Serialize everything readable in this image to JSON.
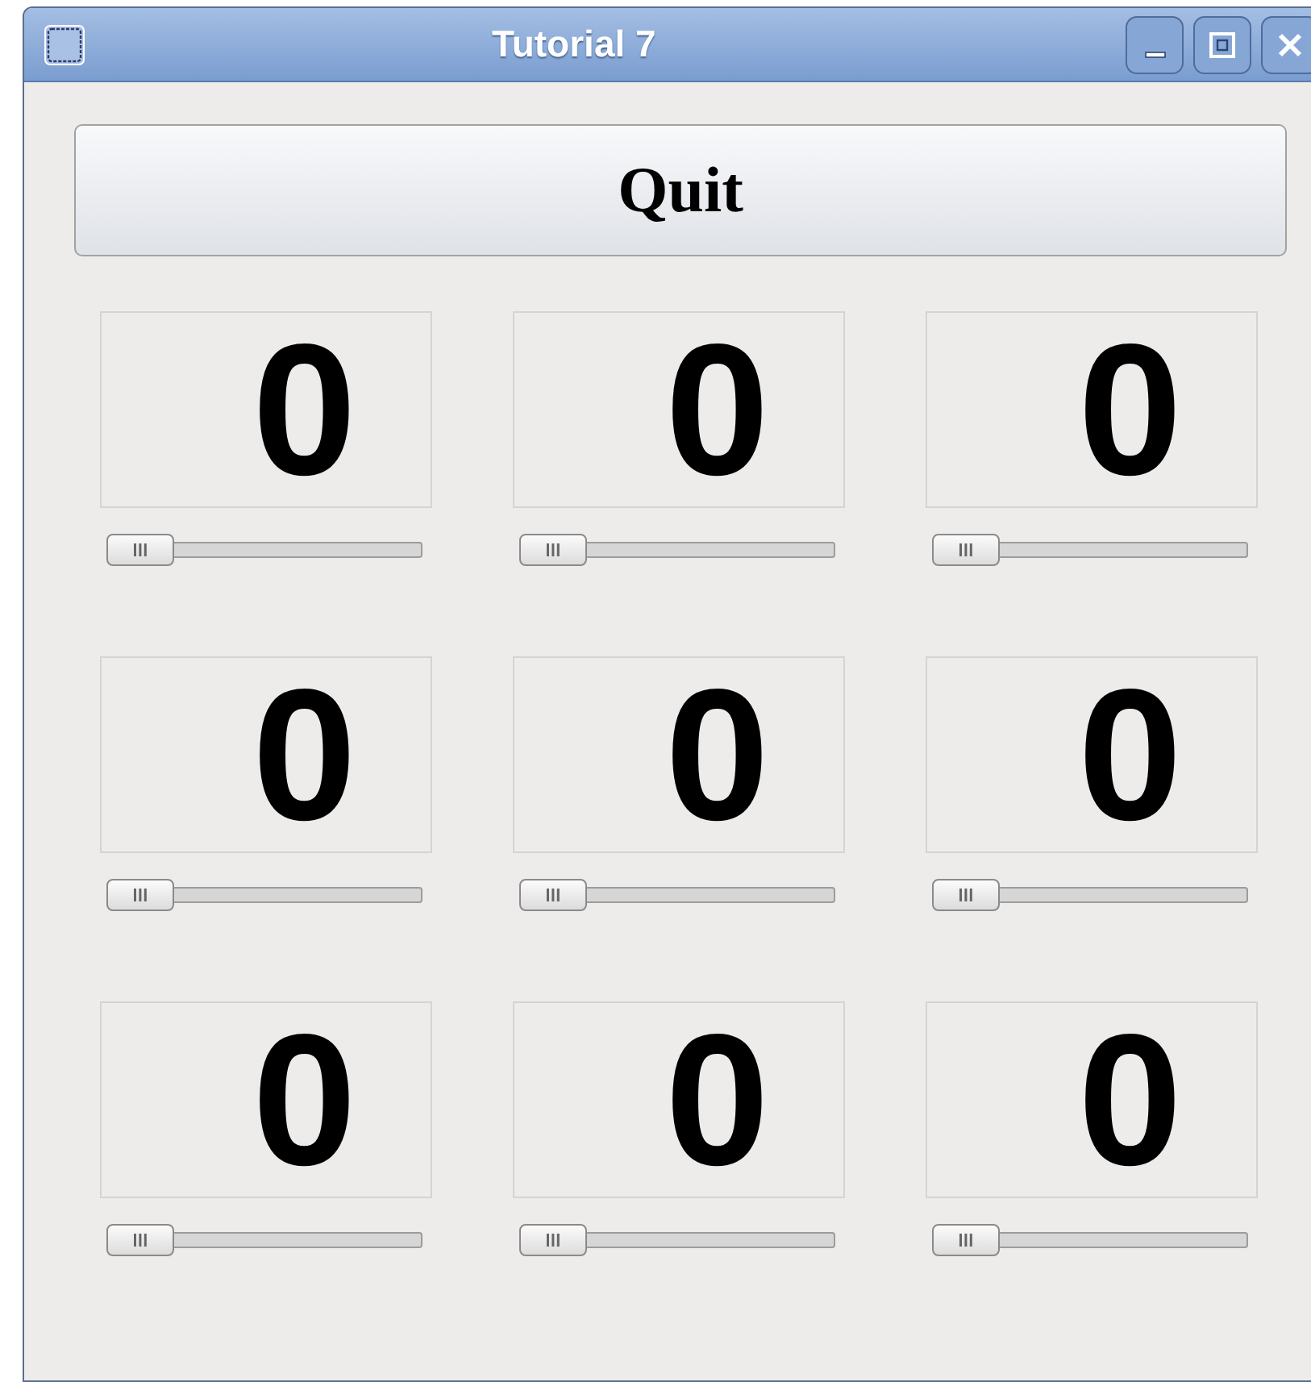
{
  "window": {
    "title": "Tutorial 7"
  },
  "quit_button": {
    "label": "Quit"
  },
  "lcd_panels": [
    {
      "value": "0",
      "slider": {
        "level": 0
      }
    },
    {
      "value": "0",
      "slider": {
        "level": 0
      }
    },
    {
      "value": "0",
      "slider": {
        "level": 0
      }
    },
    {
      "value": "0",
      "slider": {
        "level": 0
      }
    },
    {
      "value": "0",
      "slider": {
        "level": 0
      }
    },
    {
      "value": "0",
      "slider": {
        "level": 0
      }
    },
    {
      "value": "0",
      "slider": {
        "level": 0
      }
    },
    {
      "value": "0",
      "slider": {
        "level": 0
      }
    },
    {
      "value": "0",
      "slider": {
        "level": 0
      }
    }
  ]
}
